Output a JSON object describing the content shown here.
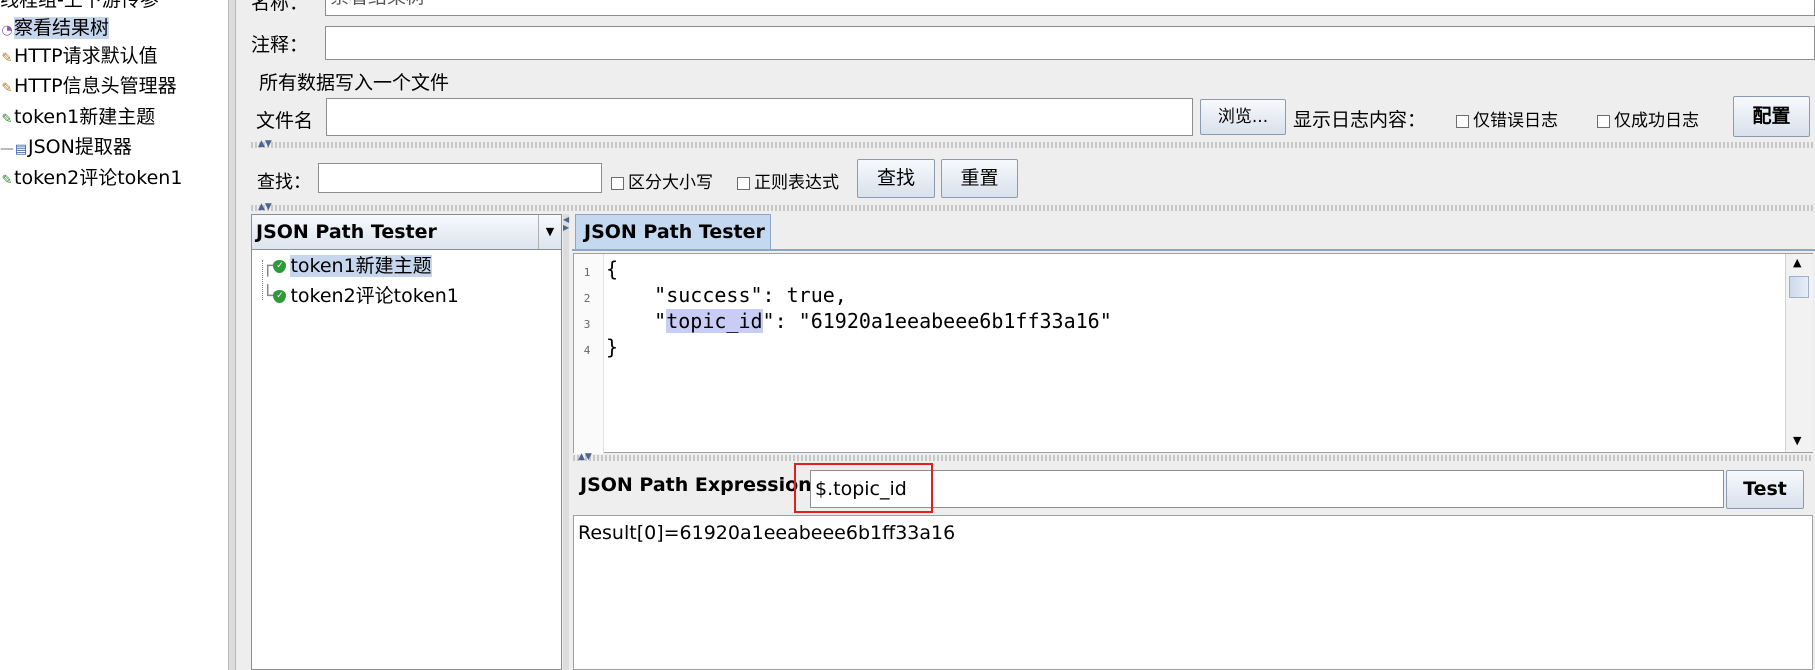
{
  "tree": {
    "items": [
      {
        "label": "线程组-上下游传参",
        "icon": "threadgroup-icon"
      },
      {
        "label": "察看结果树",
        "icon": "listener-icon"
      },
      {
        "label": "HTTP请求默认值",
        "icon": "wrench-icon"
      },
      {
        "label": "HTTP信息头管理器",
        "icon": "wrench-icon"
      },
      {
        "label": "token1新建主题",
        "icon": "sampler-pen-icon"
      },
      {
        "label": "JSON提取器",
        "icon": "extractor-icon"
      },
      {
        "label": "token2评论token1",
        "icon": "sampler-pen-icon"
      }
    ]
  },
  "form": {
    "name_label": "名称：",
    "name_value": "察看结果树",
    "comment_label": "注释：",
    "comment_value": "",
    "file_group_title": "所有数据写入一个文件",
    "filename_label": "文件名",
    "filename_value": "",
    "browse_label": "浏览...",
    "log_label": "显示日志内容：",
    "errors_only_label": "仅错误日志",
    "success_only_label": "仅成功日志",
    "configure_label": "配置"
  },
  "search": {
    "label": "查找：",
    "value": "",
    "case_label": "区分大小写",
    "regex_label": "正则表达式",
    "find_label": "查找",
    "reset_label": "重置"
  },
  "tester": {
    "combo_value": "JSON Path Tester",
    "results": [
      {
        "label": "token1新建主题",
        "selected": true
      },
      {
        "label": "token2评论token1",
        "selected": false
      }
    ],
    "tab_label": "JSON Path Tester",
    "code_lines": [
      {
        "num": "1",
        "text": "{"
      },
      {
        "num": "2",
        "text": "    \"success\": true,"
      },
      {
        "num": "3",
        "text": "    \"topic_id\": \"61920a1eeabeee6b1ff33a16\""
      },
      {
        "num": "4",
        "text": "}"
      }
    ],
    "code_line3_prefix": "    \"",
    "code_line3_key": "topic_id",
    "code_line3_suffix": "\": \"61920a1eeabeee6b1ff33a16\"",
    "expression_label": "JSON Path Expression",
    "expression_value": "$.topic_id",
    "test_label": "Test",
    "result_text": "Result[0]=61920a1eeabeee6b1ff33a16"
  },
  "colors": {
    "selection": "#c6d6ec",
    "tab": "#c4d8f0",
    "highlight": "#c9ccf4",
    "annotation": "#e02020"
  }
}
